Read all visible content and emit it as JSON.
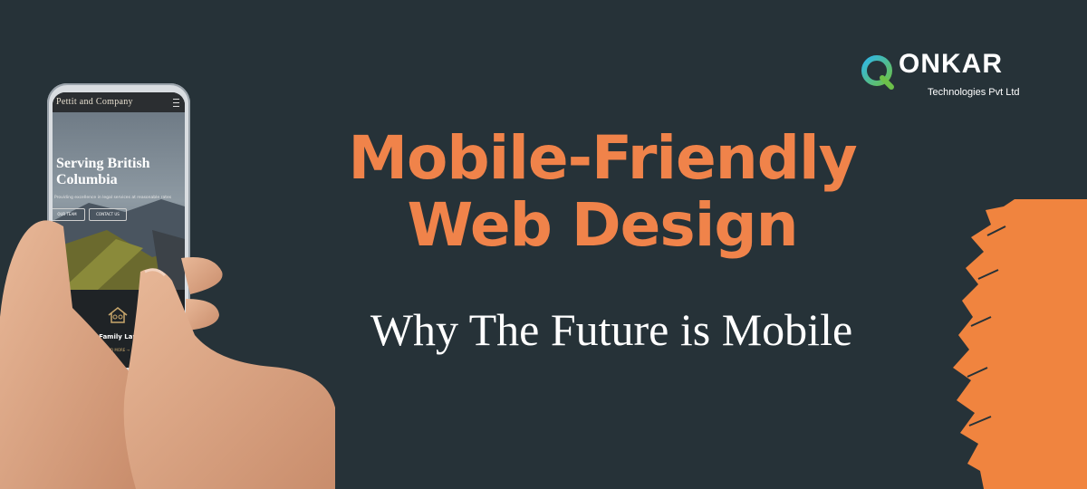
{
  "headline": {
    "line1": "Mobile-Friendly",
    "line2": "Web Design",
    "subtitle": "Why The Future is Mobile"
  },
  "logo": {
    "name": "ONKAR",
    "tagline": "Technologies Pvt Ltd"
  },
  "phone_site": {
    "brand": "Pettit and Company",
    "hero_title": "Serving British Columbia",
    "hero_tagline": "Providing excellence in legal services at reasonable rates",
    "buttons": [
      "OUR TEAM",
      "CONTACT US"
    ],
    "service_title": "Family Law",
    "service_link": "READ MORE →"
  },
  "colors": {
    "background": "#263238",
    "accent": "#f0834a",
    "subtitle": "#ffffff"
  }
}
